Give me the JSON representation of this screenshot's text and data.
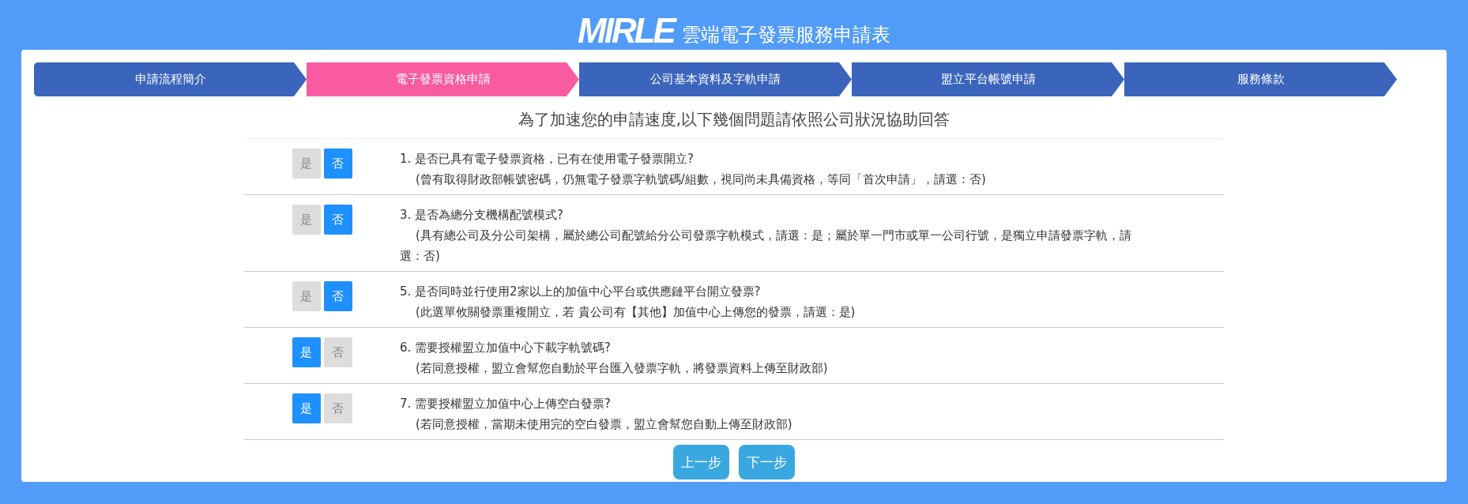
{
  "header": {
    "logo": "MIRLE",
    "title": "雲端電子發票服務申請表"
  },
  "steps": [
    {
      "label": "申請流程簡介",
      "selected": false
    },
    {
      "label": "電子發票資格申請",
      "selected": true
    },
    {
      "label": "公司基本資料及字軌申請",
      "selected": false
    },
    {
      "label": "盟立平台帳號申請",
      "selected": false
    },
    {
      "label": "服務條款",
      "selected": false
    }
  ],
  "intro": "為了加速您的申請速度,以下幾個問題請依照公司狀況協助回答",
  "questions": [
    {
      "title": "1. 是否已具有電子發票資格，已有在使用電子發票開立?",
      "note": "(曾有取得財政部帳號密碼，仍無電子發票字軌號碼/組數，視同尚未具備資格，等同「首次申請」，請選：否)",
      "options": [
        {
          "label": "是",
          "selected": false
        },
        {
          "label": "否",
          "selected": true
        }
      ]
    },
    {
      "title": "3. 是否為總分支機構配號模式?",
      "note": "(具有總公司及分公司架構，屬於總公司配號給分公司發票字軌模式，請選：是；屬於單一門市或單一公司行號，是獨立申請發票字軌，請選：否)",
      "options": [
        {
          "label": "是",
          "selected": false
        },
        {
          "label": "否",
          "selected": true
        }
      ]
    },
    {
      "title": "5. 是否同時並行使用2家以上的加值中心平台或供應鏈平台開立發票?",
      "note": "(此選單攸關發票重複開立，若 貴公司有【其他】加值中心上傳您的發票，請選：是)",
      "options": [
        {
          "label": "是",
          "selected": false
        },
        {
          "label": "否",
          "selected": true
        }
      ]
    },
    {
      "title": "6. 需要授權盟立加值中心下載字軌號碼?",
      "note": "(若同意授權，盟立會幫您自動於平台匯入發票字軌，將發票資料上傳至財政部)",
      "options": [
        {
          "label": "是",
          "selected": true
        },
        {
          "label": "否",
          "selected": false
        }
      ]
    },
    {
      "title": "7. 需要授權盟立加值中心上傳空白發票?",
      "note": "(若同意授權，當期未使用完的空白發票，盟立會幫您自動上傳至財政部)",
      "options": [
        {
          "label": "是",
          "selected": true
        },
        {
          "label": "否",
          "selected": false
        }
      ]
    }
  ],
  "buttons": [
    "上一步",
    "下一步"
  ]
}
